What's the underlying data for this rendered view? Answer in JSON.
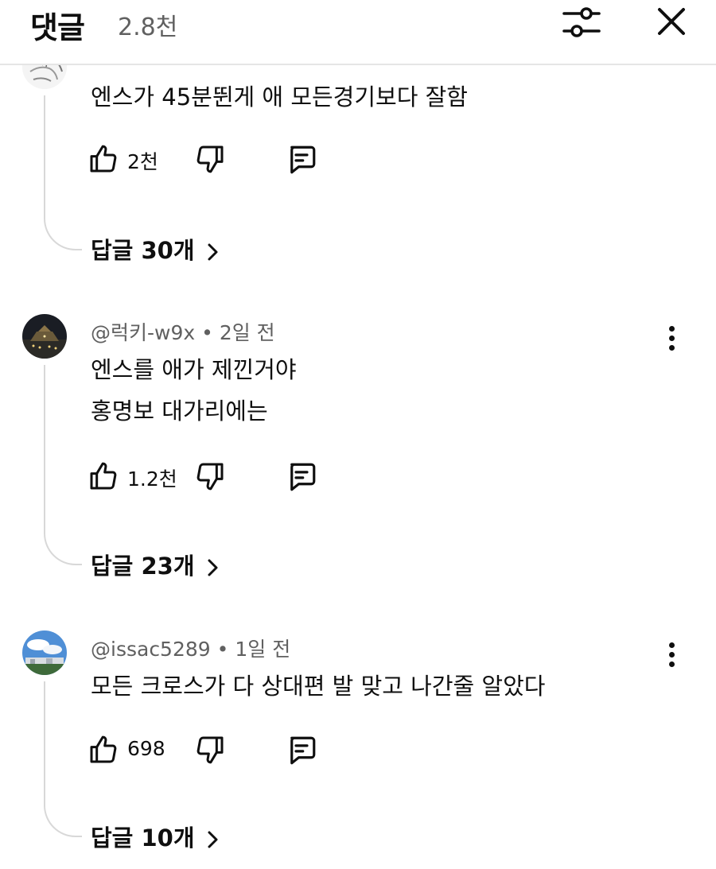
{
  "header": {
    "title": "댓글",
    "count": "2.8천"
  },
  "comments": [
    {
      "author": "",
      "time": "",
      "lines": [
        "엔스가 45분뛴게 애 모든경기보다 잘함"
      ],
      "likes": "2천",
      "replies_label": "답글 30개"
    },
    {
      "author": "@럭키-w9x",
      "time": "2일 전",
      "lines": [
        "엔스를 애가 제낀거야",
        "홍명보 대가리에는"
      ],
      "likes": "1.2천",
      "replies_label": "답글 23개"
    },
    {
      "author": "@issac5289",
      "time": "1일 전",
      "lines": [
        "모든 크로스가 다 상대편 발 맞고 나간줄 알았다"
      ],
      "likes": "698",
      "replies_label": "답글 10개"
    }
  ],
  "icons": {
    "filter": "sliders-icon",
    "close": "close-icon",
    "like": "thumbs-up-icon",
    "dislike": "thumbs-down-icon",
    "reply": "comment-icon",
    "more": "more-vertical-icon",
    "chevron": "chevron-right-icon"
  }
}
